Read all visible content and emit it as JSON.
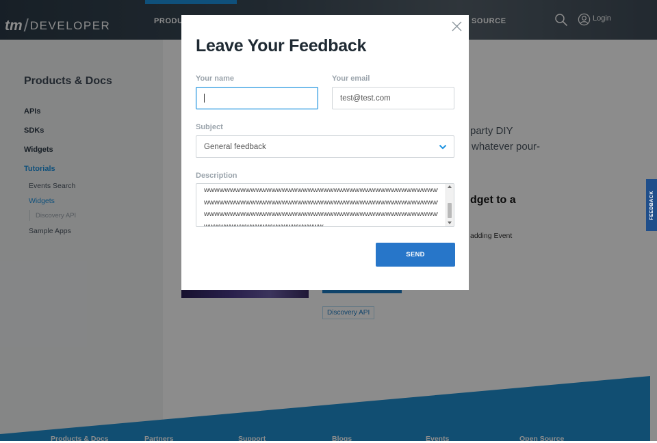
{
  "header": {
    "logo_tm": "tm",
    "logo_slash": "/",
    "logo_text": "DEVELOPER",
    "nav": [
      "PRODU",
      "SOURCE"
    ],
    "login_label": "Login"
  },
  "sidebar": {
    "title": "Products & Docs",
    "items": [
      {
        "label": "APIs"
      },
      {
        "label": "SDKs"
      },
      {
        "label": "Widgets"
      },
      {
        "label": "Tutorials"
      }
    ],
    "sub_items": [
      {
        "label": "Events Search"
      },
      {
        "label": "Widgets"
      },
      {
        "label": "Discovery API"
      },
      {
        "label": "Sample Apps"
      }
    ]
  },
  "content": {
    "line1": "party DIY",
    "line2": "whatever pour-",
    "heading_fragment": "dget to a",
    "small_fragment": "adding Event",
    "tag": "Discovery API"
  },
  "feedback_tab": "FEEDBACK",
  "footer": {
    "links": [
      "Products & Docs",
      "Partners",
      "Support",
      "Blogs",
      "Events",
      "Open Source"
    ]
  },
  "modal": {
    "title": "Leave Your Feedback",
    "name_label": "Your name",
    "name_value": "",
    "email_label": "Your email",
    "email_value": "test@test.com",
    "subject_label": "Subject",
    "subject_value": "General feedback",
    "description_label": "Description",
    "description_lines": [
      "wwwwwwwwwwwwwwwwwwwwwwwwwwwwwwwwwwwwwwwwwwwwwwwwwwwwwwwwwwwwwwww",
      "wwwwwwwwwwwwwwwwwwwwwwwwwwwwwwwwwwwwwwwwwwwwwwwwwwwwwwwwwwwwwwww",
      "wwwwwwwwwwwwwwwwwwwwwwwwwwwwwwwwwwwwwwwwwwwwwwwwwwwwwwwwwwwwwwww",
      "wwwwwwwwwwwwwwwwwwwwwww"
    ],
    "send_label": "SEND"
  },
  "colors": {
    "accent": "#1d93e0",
    "send_button": "#2776c9",
    "footer_blue": "#1f8fcf"
  }
}
